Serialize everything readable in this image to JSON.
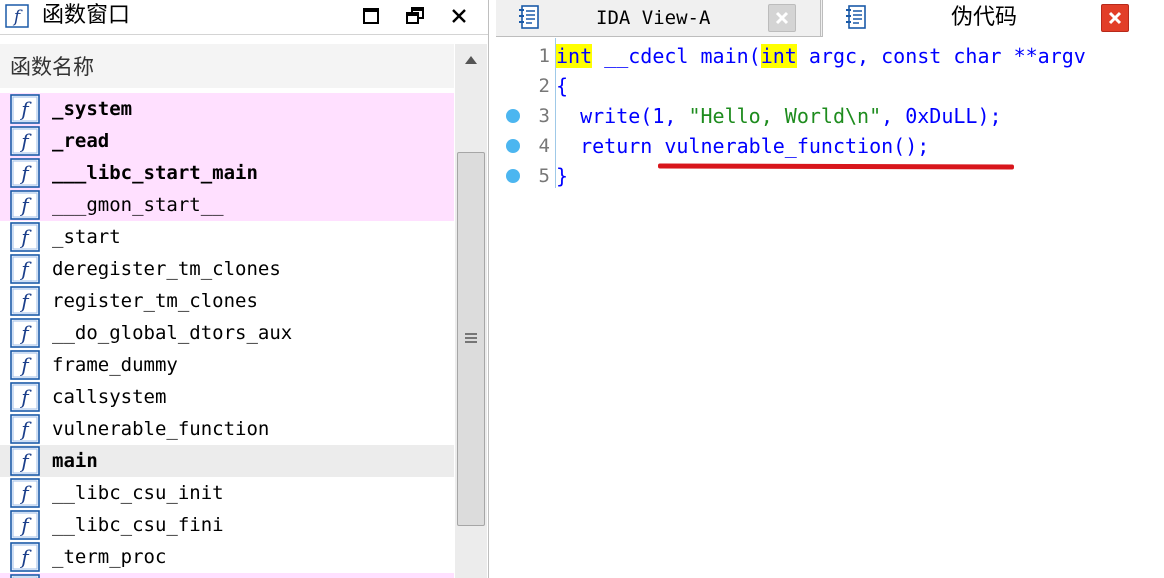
{
  "left_pane": {
    "title": "函数窗口",
    "column_header": "函数名称",
    "functions": [
      {
        "name": "_system",
        "bold": true,
        "style": "imported"
      },
      {
        "name": "_read",
        "bold": true,
        "style": "imported"
      },
      {
        "name": "___libc_start_main",
        "bold": true,
        "style": "imported"
      },
      {
        "name": "___gmon_start__",
        "bold": false,
        "style": "imported"
      },
      {
        "name": "_start",
        "bold": false,
        "style": "normal"
      },
      {
        "name": "deregister_tm_clones",
        "bold": false,
        "style": "normal"
      },
      {
        "name": "register_tm_clones",
        "bold": false,
        "style": "normal"
      },
      {
        "name": "__do_global_dtors_aux",
        "bold": false,
        "style": "normal"
      },
      {
        "name": "frame_dummy",
        "bold": false,
        "style": "normal"
      },
      {
        "name": "callsystem",
        "bold": false,
        "style": "normal"
      },
      {
        "name": "vulnerable_function",
        "bold": false,
        "style": "normal"
      },
      {
        "name": "main",
        "bold": true,
        "style": "selected"
      },
      {
        "name": "__libc_csu_init",
        "bold": false,
        "style": "normal"
      },
      {
        "name": "__libc_csu_fini",
        "bold": false,
        "style": "normal"
      },
      {
        "name": "_term_proc",
        "bold": false,
        "style": "normal"
      },
      {
        "name": "",
        "bold": false,
        "style": "imported"
      }
    ]
  },
  "tabs": [
    {
      "label": "IDA View-A",
      "active": false
    },
    {
      "label": "伪代码",
      "active": true
    }
  ],
  "code": {
    "lines": [
      {
        "num": "1",
        "bp": false
      },
      {
        "num": "2",
        "bp": false
      },
      {
        "num": "3",
        "bp": true
      },
      {
        "num": "4",
        "bp": true
      },
      {
        "num": "5",
        "bp": true
      }
    ],
    "l1": {
      "kw1": "int",
      "mid": " __cdecl main(",
      "kw2": "int",
      "rest": " argc, const char **argv"
    },
    "l2": "{",
    "l3": {
      "pre": "  write(1, ",
      "str": "\"Hello, World\\n\"",
      "post": ", 0xDuLL);"
    },
    "l4": "  return vulnerable_function();",
    "l5": "}"
  },
  "colors": {
    "imported_row": "#ffe0ff",
    "selected_row": "#ececec",
    "code_text": "#0000ff",
    "keyword_highlight": "#ffff00",
    "string": "#1e8c1e",
    "breakpoint_dot": "#4cb6f0",
    "annotation_underline": "#d8161c",
    "active_tab_close": "#e23e28"
  }
}
